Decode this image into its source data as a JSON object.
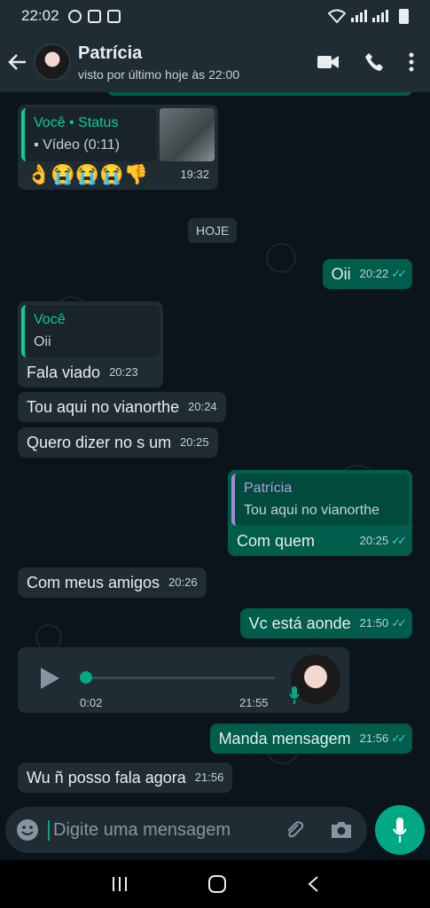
{
  "status_bar": {
    "time": "22:02"
  },
  "header": {
    "contact_name": "Patrícia",
    "last_seen": "visto por último hoje às 22:00"
  },
  "messages": [
    {
      "direction": "in",
      "quote_author": "Você • Status",
      "quote_text": "Vídeo (0:11)",
      "text": "👌😭😭😭👎",
      "time": "19:32"
    },
    {
      "direction": "system",
      "text": "HOJE"
    },
    {
      "direction": "out",
      "text": "Oii",
      "time": "20:22"
    },
    {
      "direction": "in",
      "quote_author": "Você",
      "quote_text": "Oii",
      "text": "Fala viado",
      "time": "20:23"
    },
    {
      "direction": "in",
      "text": "Tou aqui no vianorthe",
      "time": "20:24"
    },
    {
      "direction": "in",
      "text": "Quero dizer no s um",
      "time": "20:25"
    },
    {
      "direction": "out",
      "quote_author": "Patrícia",
      "quote_text": "Tou aqui no vianorthe",
      "text": "Com quem",
      "time": "20:25"
    },
    {
      "direction": "in",
      "text": "Com meus amigos",
      "time": "20:26"
    },
    {
      "direction": "out",
      "text": "Vc está aonde",
      "time": "21:50"
    },
    {
      "direction": "in",
      "type": "voice",
      "duration": "0:02",
      "time": "21:55",
      "progress": 0
    },
    {
      "direction": "out",
      "text": "Manda mensagem",
      "time": "21:56"
    },
    {
      "direction": "in",
      "text": "Wu ñ posso fala agora",
      "time": "21:56"
    }
  ],
  "composer": {
    "placeholder": "Digite uma mensagem"
  },
  "icons": [
    "whatsapp-icon",
    "notification-icon",
    "check-icon",
    "wifi-icon",
    "signal-icon",
    "battery-icon",
    "back-arrow-icon",
    "video-call-icon",
    "phone-icon",
    "more-icon",
    "emoji-icon",
    "attach-icon",
    "camera-icon",
    "mic-icon",
    "play-icon",
    "recents-icon",
    "home-icon",
    "nav-back-icon"
  ],
  "colors": {
    "header": "#1f2c34",
    "incoming": "#1f2c34",
    "outgoing": "#005c4b",
    "accent": "#00a884",
    "read_ticks": "#53bdeb"
  }
}
